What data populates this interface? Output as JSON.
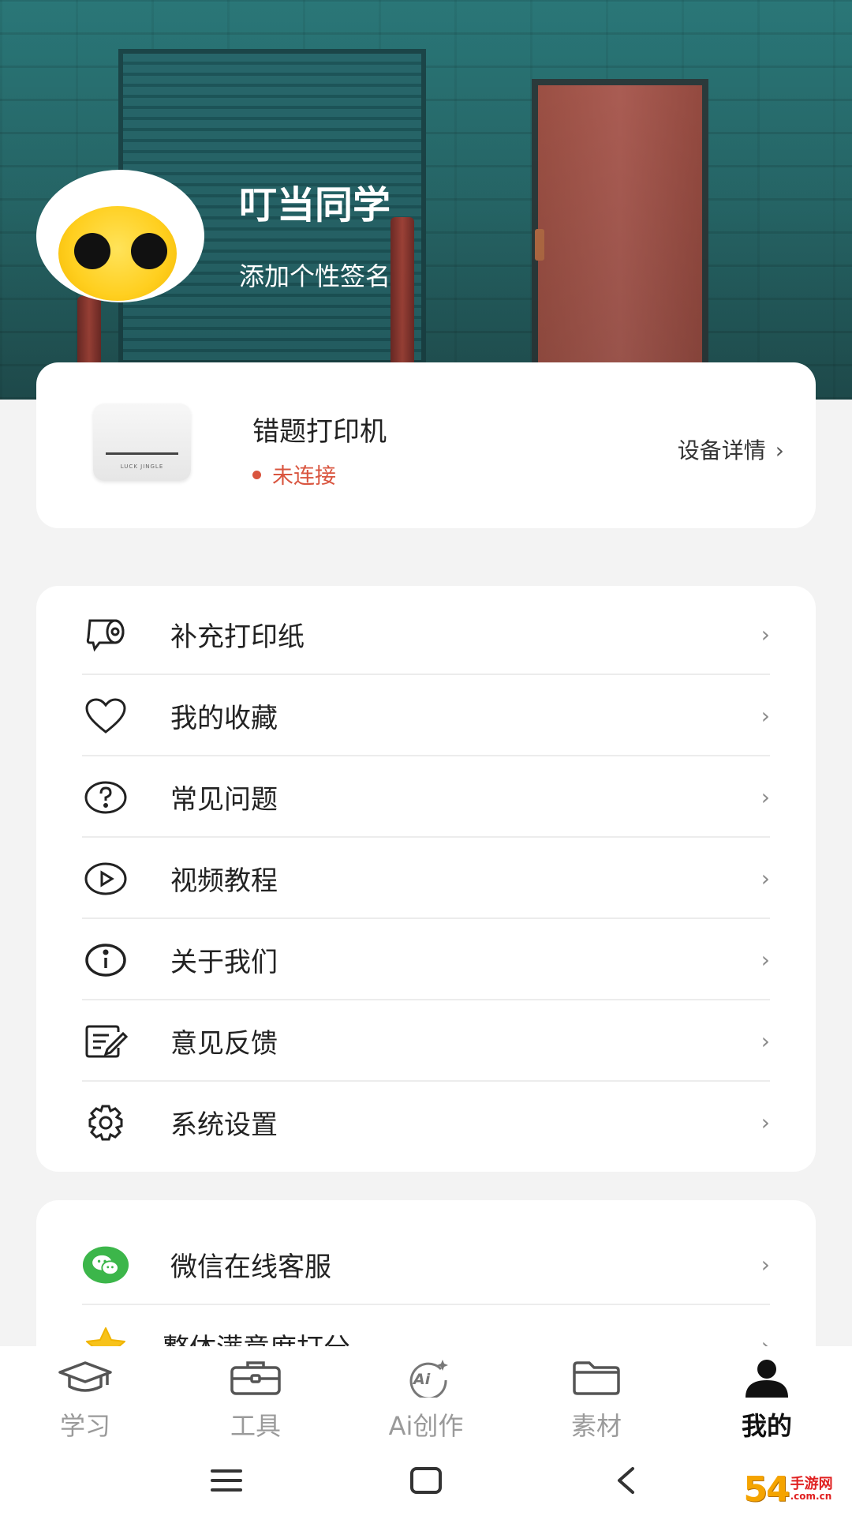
{
  "profile": {
    "name": "叮当同学",
    "signature": "添加个性签名"
  },
  "device": {
    "name": "错题打印机",
    "brand_text": "LUCK JINGLE",
    "status": "未连接",
    "detail_label": "设备详情",
    "status_color": "#d9553f"
  },
  "menu": {
    "items": [
      {
        "label": "补充打印纸",
        "icon": "paper-roll-icon"
      },
      {
        "label": "我的收藏",
        "icon": "heart-icon"
      },
      {
        "label": "常见问题",
        "icon": "question-icon"
      },
      {
        "label": "视频教程",
        "icon": "play-icon"
      },
      {
        "label": "关于我们",
        "icon": "info-icon"
      },
      {
        "label": "意见反馈",
        "icon": "feedback-icon"
      },
      {
        "label": "系统设置",
        "icon": "gear-icon"
      }
    ]
  },
  "extra": {
    "items": [
      {
        "label": "微信在线客服",
        "icon": "wechat-icon"
      },
      {
        "label": "整体满意度打分",
        "icon": "star-icon"
      }
    ]
  },
  "tabs": [
    {
      "label": "学习",
      "icon": "graduation-cap-icon",
      "active": false
    },
    {
      "label": "工具",
      "icon": "toolbox-icon",
      "active": false
    },
    {
      "label": "Ai创作",
      "icon": "ai-icon",
      "active": false
    },
    {
      "label": "素材",
      "icon": "folder-icon",
      "active": false
    },
    {
      "label": "我的",
      "icon": "person-icon",
      "active": true
    }
  ],
  "watermark": {
    "number": "54",
    "site": "手游网",
    "domain": ".com.cn"
  },
  "colors": {
    "accent_red": "#d9553f",
    "banner_teal": "#2a7172",
    "wechat_green": "#3cb64a",
    "star_yellow": "#f7c21a"
  }
}
